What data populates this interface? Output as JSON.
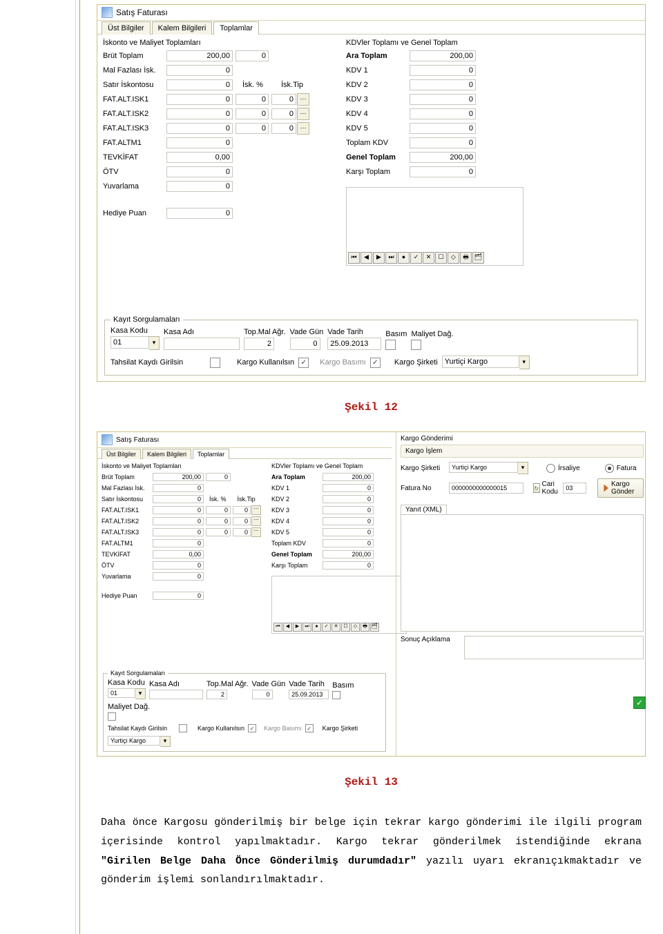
{
  "captions": {
    "s12": "Şekil 12",
    "s13": "Şekil 13"
  },
  "window": {
    "title": "Satış Faturası",
    "tabs": {
      "ust": "Üst Bilgiler",
      "kalem": "Kalem Bilgileri",
      "top": "Toplamlar"
    },
    "left_title": "İskonto ve Maliyet Toplamları",
    "right_title": "KDVler Toplamı ve Genel Toplam",
    "left": {
      "brut": "Brüt Toplam",
      "brut_v1": "200,00",
      "brut_v2": "0",
      "mal": "Mal Fazlası İsk.",
      "mal_v": "0",
      "satir": "Satır İskontosu",
      "satir_v": "0",
      "isk_pct": "İsk. %",
      "isk_tip": "İsk.Tip",
      "isk1": "FAT.ALT.ISK1",
      "isk1_a": "0",
      "isk1_b": "0",
      "isk1_c": "0",
      "isk2": "FAT.ALT.ISK2",
      "isk2_a": "0",
      "isk2_b": "0",
      "isk2_c": "0",
      "isk3": "FAT.ALT.ISK3",
      "isk3_a": "0",
      "isk3_b": "0",
      "isk3_c": "0",
      "altm1": "FAT.ALTM1",
      "altm1_v": "0",
      "tevk": "TEVKİFAT",
      "tevk_v": "0,00",
      "otv": "ÖTV",
      "otv_v": "0",
      "yuv": "Yuvarlama",
      "yuv_v": "0",
      "hediye": "Hediye Puan",
      "hediye_v": "0"
    },
    "right": {
      "ara": "Ara Toplam",
      "ara_v": "200,00",
      "kdv1": "KDV 1",
      "kdv1_v": "0",
      "kdv2": "KDV 2",
      "kdv2_v": "0",
      "kdv3": "KDV 3",
      "kdv3_v": "0",
      "kdv4": "KDV 4",
      "kdv4_v": "0",
      "kdv5": "KDV 5",
      "kdv5_v": "0",
      "topkdv": "Toplam KDV",
      "topkdv_v": "0",
      "genel": "Genel Toplam",
      "genel_v": "200,00",
      "karsi": "Karşı Toplam",
      "karsi_v": "0"
    },
    "kayit": {
      "legend": "Kayıt Sorgulamaları",
      "kasa_kodu": "Kasa Kodu",
      "kasa_kodu_v": "01",
      "kasa_adi": "Kasa Adı",
      "kasa_adi_v": "",
      "top_mal": "Top.Mal Ağr.",
      "top_mal_v": "2",
      "vade_gun": "Vade Gün",
      "vade_gun_v": "0",
      "vade_tarih": "Vade Tarih",
      "vade_tarih_v": "25.09.2013",
      "basim": "Basım",
      "maliyet": "Maliyet Dağ.",
      "tahsilat": "Tahsilat Kaydı Girilsin",
      "kargo_kul": "Kargo Kullanılsın",
      "kargo_bas": "Kargo Basımı",
      "kargo_sirketi": "Kargo Şirketi",
      "kargo_sirketi_v": "Yurtiçi Kargo"
    },
    "toolbar_icons": [
      "⏮",
      "◀",
      "▶",
      "⏭",
      "●",
      "✓",
      "✕",
      "☐",
      "◇",
      "🖶",
      "🗂"
    ]
  },
  "kg": {
    "header": "Kargo Gönderimi",
    "islem": "Kargo İşlem",
    "sirket": "Kargo Şirketi",
    "sirket_v": "Yurtiçi Kargo",
    "irsaliye": "İrsaliye",
    "fatura": "Fatura",
    "fatura_no": "Fatura No",
    "fatura_no_v": "0000000000000015",
    "cari": "Cari Kodu",
    "cari_v": "03",
    "gonder": "Kargo Gönder",
    "yanit": "Yanıt (XML)",
    "sonuc": "Sonuç Açıklama"
  },
  "prose": {
    "p1a": "Daha önce Kargosu gönderilmiş bir belge için tekrar kargo gönderimi ile ilgili program içerisinde kontrol yapılmaktadır. Kargo tekrar gönderilmek istendiğinde ekrana ",
    "p1b": "\"Girilen Belge Daha Önce Gönderilmiş durumdadır\"",
    "p1c": " yazılı uyarı ekranıçıkmaktadır ve gönderim işlemi sonlandırılmaktadır."
  }
}
